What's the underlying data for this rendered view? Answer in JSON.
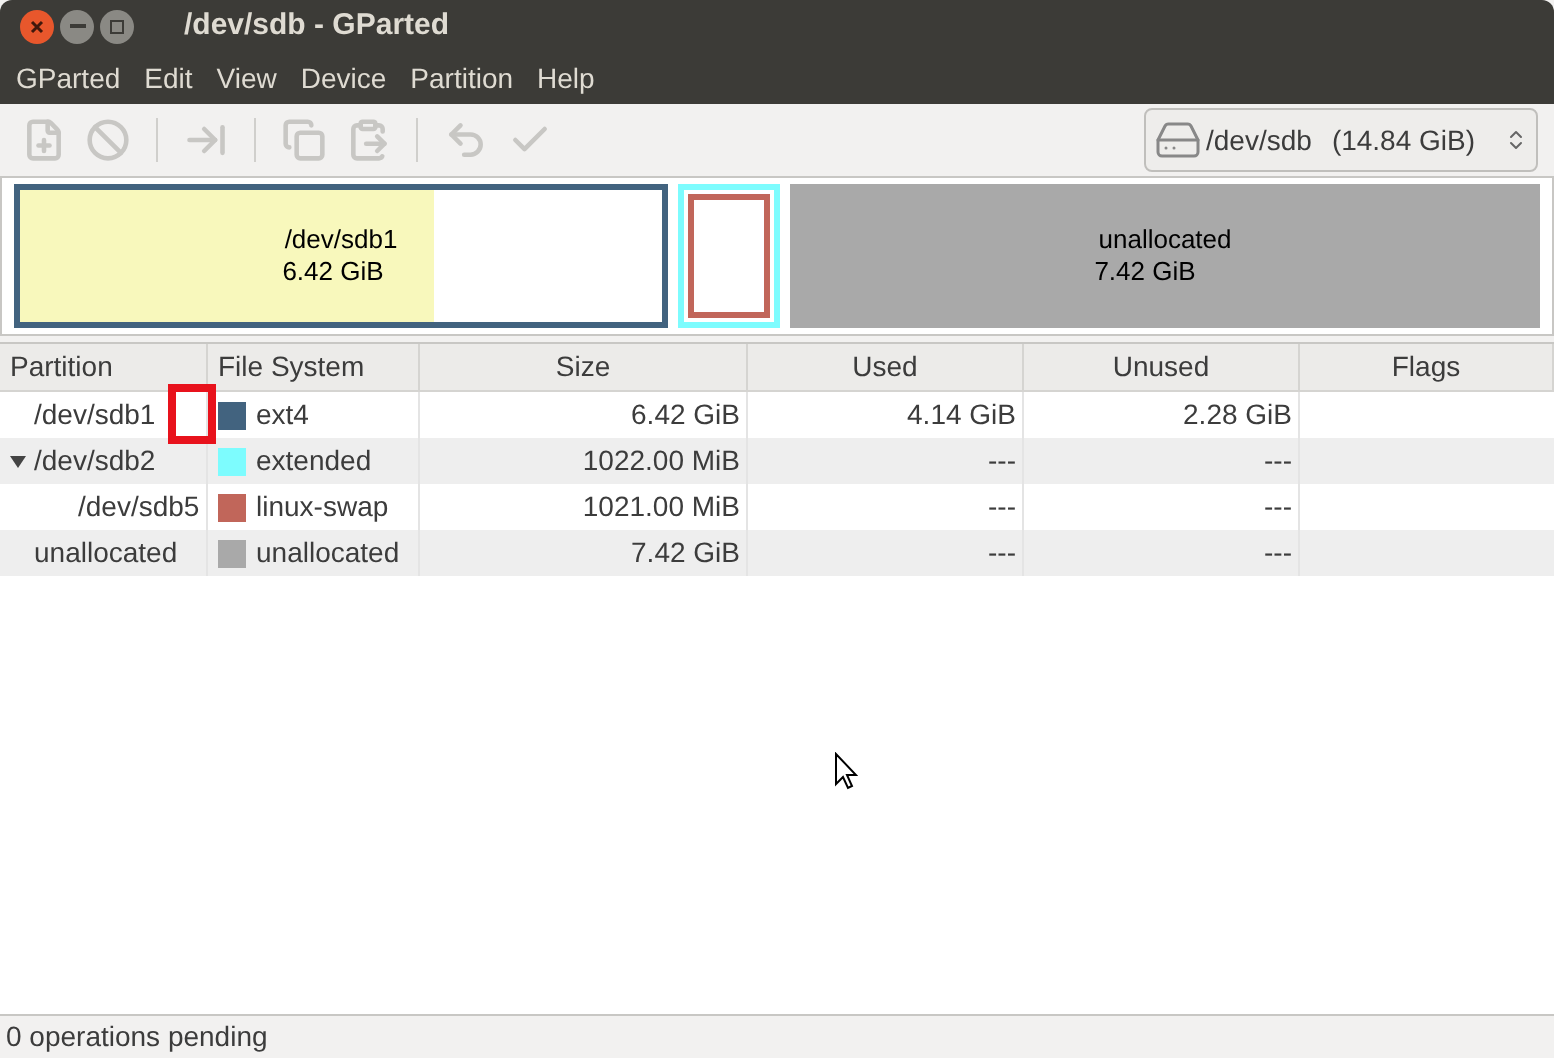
{
  "window": {
    "title": "/dev/sdb - GParted"
  },
  "menu": [
    "GParted",
    "Edit",
    "View",
    "Device",
    "Partition",
    "Help"
  ],
  "toolbar": [
    {
      "kind": "new",
      "disabled": true
    },
    {
      "kind": "delete",
      "disabled": true
    },
    {
      "kind": "sep"
    },
    {
      "kind": "resize",
      "disabled": true
    },
    {
      "kind": "sep"
    },
    {
      "kind": "copy",
      "disabled": true
    },
    {
      "kind": "paste",
      "disabled": true
    },
    {
      "kind": "sep"
    },
    {
      "kind": "undo",
      "disabled": true
    },
    {
      "kind": "apply",
      "disabled": true
    }
  ],
  "device_selector": {
    "device": "/dev/sdb",
    "size": "(14.84 GiB)"
  },
  "disk_map": [
    {
      "kind": "primary",
      "name": "/dev/sdb1",
      "size": "6.42 GiB",
      "color": "#42637f",
      "level": 0.645
    },
    {
      "kind": "extended",
      "color": "#7dfcfe",
      "children": [
        {
          "kind": "swap",
          "color": "#c1665a"
        }
      ]
    },
    {
      "kind": "unallocated",
      "name": "unallocated",
      "size": "7.42 GiB",
      "color": "#a9a9a9"
    }
  ],
  "table": {
    "columns": [
      "Partition",
      "File System",
      "Size",
      "Used",
      "Unused",
      "Flags"
    ],
    "rows": [
      {
        "partition": "/dev/sdb1",
        "file_system": "ext4",
        "color": "#42637f",
        "size": "6.42 GiB",
        "used": "4.14 GiB",
        "unused": "2.28 GiB"
      },
      {
        "partition": "/dev/sdb2",
        "file_system": "extended",
        "color": "#7dfcfe",
        "size": "1022.00 MiB",
        "used": "---",
        "unused": "---",
        "expanded": true,
        "children": [
          {
            "partition": "/dev/sdb5",
            "file_system": "linux-swap",
            "color": "#c1665a",
            "size": "1021.00 MiB",
            "used": "---",
            "unused": "---"
          }
        ]
      },
      {
        "partition": "unallocated",
        "file_system": "unallocated",
        "color": "#a9a9a9",
        "size": "7.42 GiB",
        "used": "---",
        "unused": "---"
      }
    ]
  },
  "status_bar": "0 operations pending"
}
